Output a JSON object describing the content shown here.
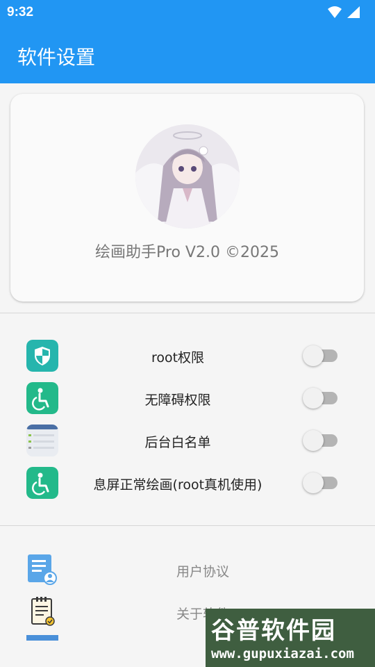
{
  "status_bar": {
    "time": "9:32"
  },
  "app_bar": {
    "title": "软件设置"
  },
  "header_card": {
    "version_text": "绘画助手Pro V2.0 ©2025"
  },
  "permissions": [
    {
      "label": "root权限",
      "icon": "shield-icon",
      "icon_color": "#26b5ad",
      "enabled": false
    },
    {
      "label": "无障碍权限",
      "icon": "accessibility-icon",
      "icon_color": "#23b98a",
      "enabled": false
    },
    {
      "label": "后台白名单",
      "icon": "app-list-icon",
      "icon_color": "#e6eaf0",
      "enabled": false
    },
    {
      "label": "息屏正常绘画(root真机使用)",
      "icon": "accessibility-icon",
      "icon_color": "#23b98a",
      "enabled": false
    }
  ],
  "links": [
    {
      "label": "用户协议",
      "icon": "user-agreement-icon"
    },
    {
      "label": "关于软件",
      "icon": "about-clipboard-icon"
    }
  ],
  "watermark": {
    "big": "谷普软件园",
    "small": "www.gupuxiazai.com"
  },
  "colors": {
    "primary": "#2196f3",
    "background": "#f5f5f5"
  }
}
